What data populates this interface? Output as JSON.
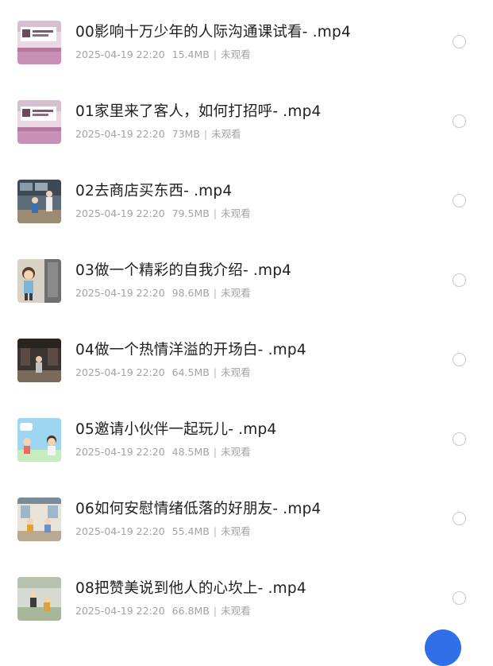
{
  "files": [
    {
      "title": "00影响十万少年的人际沟通课试看- .mp4",
      "date": "2025-04-19 22:20",
      "size": "15.4MB",
      "status": "未观看",
      "thumb_icon": "video-thumbnail-classroom-sign"
    },
    {
      "title": "01家里来了客人，如何打招呼- .mp4",
      "date": "2025-04-19 22:20",
      "size": "73MB",
      "status": "未观看",
      "thumb_icon": "video-thumbnail-classroom-sign"
    },
    {
      "title": "02去商店买东西- .mp4",
      "date": "2025-04-19 22:20",
      "size": "79.5MB",
      "status": "未观看",
      "thumb_icon": "video-thumbnail-shop-scene"
    },
    {
      "title": "03做一个精彩的自我介绍- .mp4",
      "date": "2025-04-19 22:20",
      "size": "98.6MB",
      "status": "未观看",
      "thumb_icon": "video-thumbnail-cartoon-child"
    },
    {
      "title": "04做一个热情洋溢的开场白- .mp4",
      "date": "2025-04-19 22:20",
      "size": "64.5MB",
      "status": "未观看",
      "thumb_icon": "video-thumbnail-dark-room"
    },
    {
      "title": "05邀请小伙伴一起玩儿- .mp4",
      "date": "2025-04-19 22:20",
      "size": "48.5MB",
      "status": "未观看",
      "thumb_icon": "video-thumbnail-blue-sky-kids"
    },
    {
      "title": "06如何安慰情绪低落的好朋友- .mp4",
      "date": "2025-04-19 22:20",
      "size": "55.4MB",
      "status": "未观看",
      "thumb_icon": "video-thumbnail-classroom"
    },
    {
      "title": "08把赞美说到他人的心坎上- .mp4",
      "date": "2025-04-19 22:20",
      "size": "66.8MB",
      "status": "未观看",
      "thumb_icon": "video-thumbnail-outdoor-kid"
    }
  ],
  "meta_separator": "|",
  "colors": {
    "title": "#202020",
    "meta": "#a3a3a3",
    "radio_border": "#c9c9c9",
    "fab": "#2f6fe8"
  }
}
